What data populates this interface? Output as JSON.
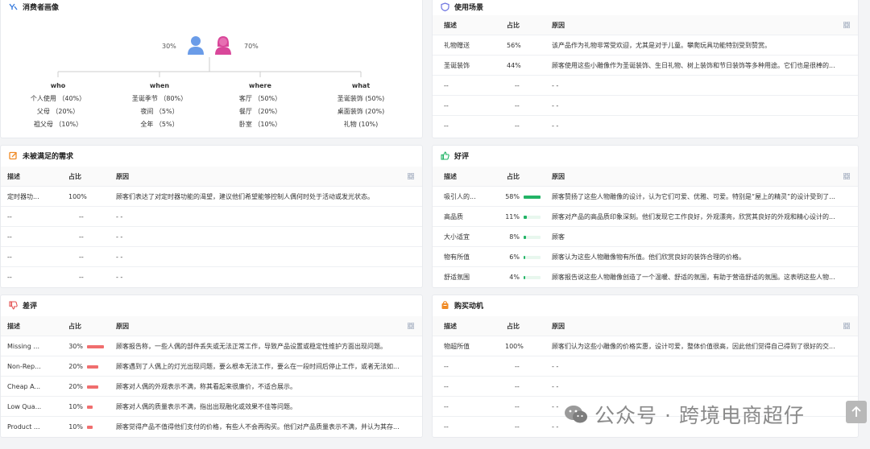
{
  "persona": {
    "title": "消费者画像",
    "male_pct": "30%",
    "female_pct": "70%",
    "columns": [
      {
        "head": "who",
        "items": [
          "个人使用 （40%）",
          "父母 （20%）",
          "祖父母 （10%）"
        ]
      },
      {
        "head": "when",
        "items": [
          "圣诞季节 （80%）",
          "夜间 （5%）",
          "全年 （5%）"
        ]
      },
      {
        "head": "where",
        "items": [
          "客厅 （50%）",
          "餐厅 （20%）",
          "卧室 （10%）"
        ]
      },
      {
        "head": "what",
        "items": [
          "圣诞装饰 (50%)",
          "桌面装饰 (20%)",
          "礼物 (10%)"
        ]
      }
    ]
  },
  "usage": {
    "title": "使用场景",
    "headers": [
      "描述",
      "占比",
      "原因"
    ],
    "rows": [
      [
        "礼物赠送",
        "56%",
        "该产品作为礼物非常受欢迎，尤其是对于儿童。攀爬玩具功能特别受到赞赏。"
      ],
      [
        "圣诞装饰",
        "44%",
        "顾客使用这些小雕像作为圣诞装饰、生日礼物、树上装饰和节日装饰等多种用途。它们也是很棒的..."
      ],
      [
        "--",
        "--",
        "- -"
      ],
      [
        "--",
        "--",
        "- -"
      ],
      [
        "--",
        "--",
        "- -"
      ]
    ]
  },
  "unmet": {
    "title": "未被满足的需求",
    "headers": [
      "描述",
      "占比",
      "原因"
    ],
    "rows": [
      [
        "定时器功...",
        "100%",
        "顾客们表达了对定时器功能的渴望，建议他们希望能够控制人偶何时处于活动或发光状态。"
      ],
      [
        "--",
        "--",
        "- -"
      ],
      [
        "--",
        "--",
        "- -"
      ],
      [
        "--",
        "--",
        "- -"
      ],
      [
        "--",
        "--",
        "- -"
      ]
    ]
  },
  "positive": {
    "title": "好评",
    "headers": [
      "描述",
      "占比",
      "原因"
    ],
    "color": "#22b366",
    "rows": [
      {
        "d": "吸引人的...",
        "p": "58%",
        "v": 0.58,
        "r": "顾客赞扬了这些人物雕像的设计，认为它们可爱、优雅、可爱。特别是“屋上的精灵”的设计受到了..."
      },
      {
        "d": "高品质",
        "p": "11%",
        "v": 0.11,
        "r": "顾客对产品的高品质印象深刻。他们发现它工作良好，外观漂亮，欣赏其良好的外观和精心设计的..."
      },
      {
        "d": "大小适宜",
        "p": "8%",
        "v": 0.08,
        "r": "顾客"
      },
      {
        "d": "物有所值",
        "p": "6%",
        "v": 0.06,
        "r": "顾客认为这些人物雕像物有所值。他们欣赏良好的装饰合理的价格。"
      },
      {
        "d": "舒适氛围",
        "p": "4%",
        "v": 0.04,
        "r": "顾客报告说这些人物雕像创造了一个温暖、舒适的氛围，有助于营造舒适的氛围。这表明这些人物..."
      }
    ]
  },
  "negative": {
    "title": "差评",
    "headers": [
      "描述",
      "占比",
      "原因"
    ],
    "color": "#f06e6e",
    "rows": [
      {
        "d": "Missing ...",
        "p": "30%",
        "v": 0.3,
        "r": "顾客报告称，一些人偶的部件丢失或无法正常工作，导致产品设置或稳定性维护方面出现问题。"
      },
      {
        "d": "Non-Rep...",
        "p": "20%",
        "v": 0.2,
        "r": "顾客遇到了人偶上的灯光出现问题，要么根本无法工作，要么在一段时间后停止工作，或者无法如..."
      },
      {
        "d": "Cheap A...",
        "p": "20%",
        "v": 0.2,
        "r": "顾客对人偶的外观表示不满，称其看起来很廉价，不适合展示。"
      },
      {
        "d": "Low Qua...",
        "p": "10%",
        "v": 0.1,
        "r": "顾客对人偶的质量表示不满，指出出现融化或效果不佳等问题。"
      },
      {
        "d": "Product ...",
        "p": "10%",
        "v": 0.1,
        "r": "顾客觉得产品不值得他们支付的价格，有些人不会再购买。他们对产品质量表示不满，并认为其存..."
      }
    ]
  },
  "motive": {
    "title": "购买动机",
    "headers": [
      "描述",
      "占比",
      "原因"
    ],
    "rows": [
      [
        "物超所值",
        "100%",
        "顾客们认为这些小雕像的价格实惠，设计可爱，整体价值很高，因此他们觉得自己得到了很好的交..."
      ],
      [
        "--",
        "--",
        "- -"
      ],
      [
        "--",
        "--",
        "- -"
      ],
      [
        "--",
        "--",
        "- -"
      ],
      [
        "--",
        "--",
        "- -"
      ]
    ]
  },
  "watermark": {
    "text": "公众号 · 跨境电商超仔"
  },
  "icons": {
    "grid": "grid-icon",
    "scroll": "arrow-up-icon"
  }
}
